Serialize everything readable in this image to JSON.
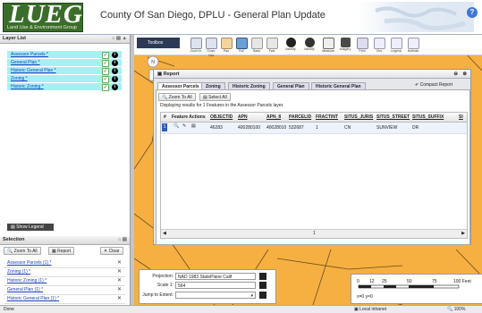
{
  "app": {
    "logo_text": "LUEG",
    "logo_subtitle": "Land Use & Environment Group",
    "title": "County Of San Diego, DPLU - General Plan Update"
  },
  "layer_list": {
    "header": "Layer List",
    "controls": "⌂ ▤ ▲",
    "layers": [
      {
        "label": "Assessor Parcels *"
      },
      {
        "label": "General Plan *"
      },
      {
        "label": "Historic General Plan *"
      },
      {
        "label": "Zoning *"
      },
      {
        "label": "Historic Zoning *"
      }
    ],
    "show_legend": "Show Legend"
  },
  "selection": {
    "header": "Selection",
    "controls": "⌂ ▤",
    "zoom_btn": "Zoom To All",
    "report_btn": "Report",
    "clear_btn": "Clear",
    "items": [
      {
        "label": "Assessor Parcels (1) *"
      },
      {
        "label": "Zoning (1) *"
      },
      {
        "label": "Historic Zoning (1) *"
      },
      {
        "label": "General Plan (1) *"
      },
      {
        "label": "Historic General Plan (1) *"
      }
    ]
  },
  "toolbar": {
    "tab_label": "Toolbox",
    "tools": [
      "Zoom In",
      "Zoom Out",
      "Pan",
      "Full",
      "Back",
      "Fwd",
      "Identify",
      "Identify",
      "Measure",
      "Imagery",
      "Print",
      "Clrs",
      "Legend",
      "Hotlinks"
    ]
  },
  "report": {
    "title": "Report",
    "compact_label": "Compact Report",
    "tabs": [
      "Assessor Parcels",
      "Zoning",
      "Historic Zoning",
      "General Plan",
      "Historic General Plan"
    ],
    "zoom_all": "Zoom To All",
    "select_all": "Select All",
    "displaying": "Displaying results for 1 Features in the Assessor Parcels layer.",
    "columns": [
      "#",
      "Feature Actions",
      "OBJECTID",
      "APN",
      "APN_8",
      "PARCELID",
      "FRACTINT",
      "SITUS_JURIS",
      "SITUS_STREET",
      "SITUS_SUFFIX",
      "SI"
    ],
    "rows": [
      [
        "1",
        "",
        "46283",
        "400280100",
        "40028010",
        "532687",
        "1",
        "CN",
        "SUNVIEW",
        "DR",
        ""
      ]
    ],
    "page_number": "1"
  },
  "bottom": {
    "projection_label": "Projection:",
    "projection_value": "NAD 1983 StatePlane Calif",
    "scale_label": "Scale 1:",
    "scale_value": "564",
    "jump_label": "Jump to Extent:",
    "scale_ticks": [
      "0",
      "12",
      "25",
      "50",
      "75",
      "100 Feet"
    ],
    "coords": "x=0 y=0"
  },
  "status": {
    "left": "Done",
    "zone": "Local intranet",
    "zoom": "100%"
  },
  "colors": {
    "map_fill": "#f6b041",
    "layer_highlight": "#a6f0f4",
    "logo_green": "#3b6d2a",
    "toolbar_tab": "#2d3a57"
  }
}
